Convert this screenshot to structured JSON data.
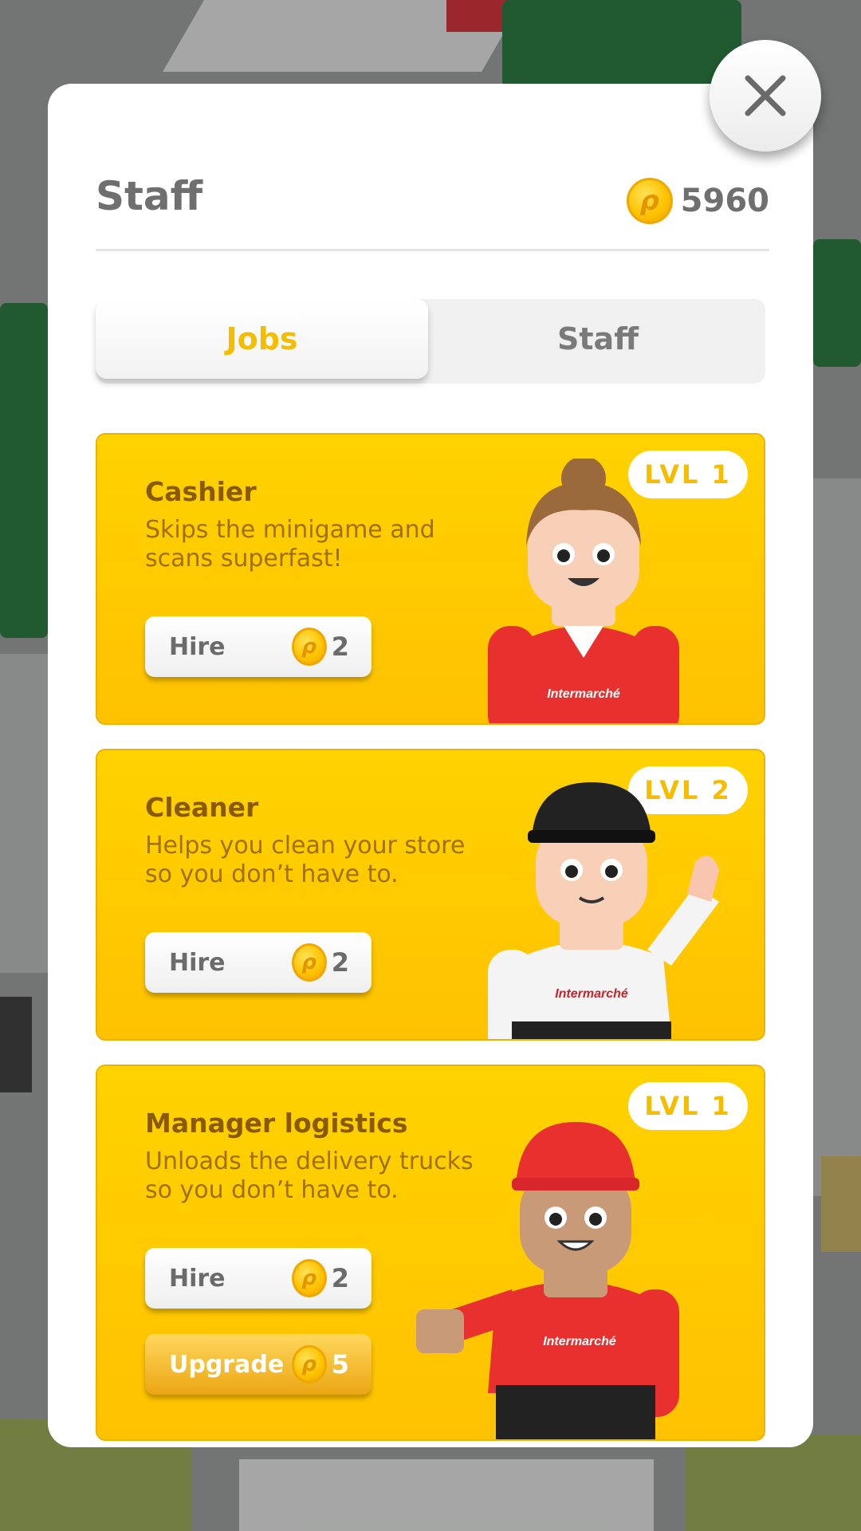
{
  "header": {
    "title": "Staff",
    "balance": "5960"
  },
  "tabs": [
    {
      "label": "Jobs",
      "active": true
    },
    {
      "label": "Staff",
      "active": false
    }
  ],
  "jobs": [
    {
      "title": "Cashier",
      "description": "Skips the minigame and scans superfast!",
      "level": "LVL 1",
      "hire": {
        "label": "Hire",
        "price": "2"
      }
    },
    {
      "title": "Cleaner",
      "description": "Helps you clean your store so you don’t have to.",
      "level": "LVL 2",
      "hire": {
        "label": "Hire",
        "price": "2"
      }
    },
    {
      "title": "Manager logistics",
      "description": "Unloads the delivery trucks so you don’t have to.",
      "level": "LVL 1",
      "hire": {
        "label": "Hire",
        "price": "2"
      },
      "upgrade": {
        "label": "Upgrade",
        "price": "5"
      }
    }
  ],
  "coin_symbol": "ρ",
  "colors": {
    "accent": "#f5bd00",
    "card": "#ffc900",
    "brand_red": "#e8302e"
  },
  "icons": {
    "close": "close-icon",
    "coin": "coin-icon"
  }
}
